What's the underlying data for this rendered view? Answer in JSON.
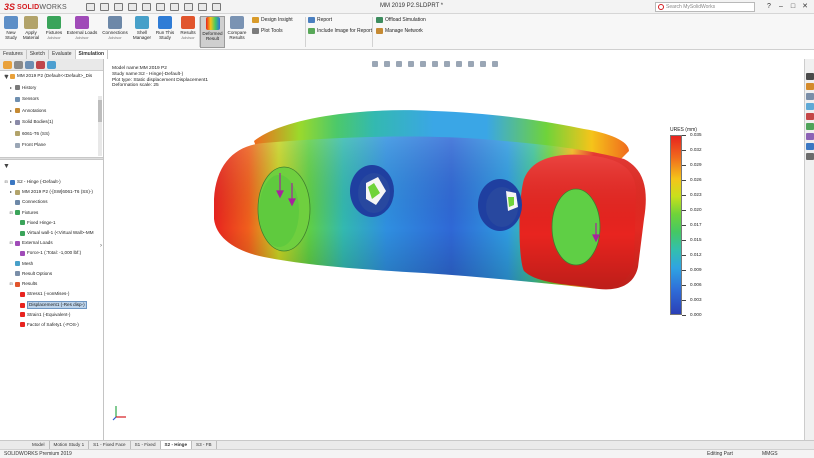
{
  "app": {
    "logo_ds": "3S",
    "logo_text_bold": "SOLID",
    "logo_text_thin": "WORKS",
    "doc_title": "MM 2019 P2.SLDPRT *",
    "search_placeholder": "Search MySolidWorks",
    "window_controls": [
      "?",
      "–",
      "□",
      "✕"
    ]
  },
  "ribbon": {
    "buttons": [
      {
        "label": "New",
        "sub": "Study",
        "icon": "new-study-icon"
      },
      {
        "label": "Apply",
        "sub": "Material",
        "icon": "apply-material-icon"
      },
      {
        "label": "Fixtures",
        "sub": "Advisor",
        "icon": "fixtures-icon"
      },
      {
        "label": "External Loads",
        "sub": "Advisor",
        "icon": "external-loads-icon"
      },
      {
        "label": "Connections",
        "sub": "Advisor",
        "icon": "connections-icon"
      },
      {
        "label": "Shell",
        "sub": "Manager",
        "icon": "shell-manager-icon"
      },
      {
        "label": "Run This",
        "sub": "Study",
        "icon": "run-study-icon"
      },
      {
        "label": "Results",
        "sub": "Advisor",
        "icon": "results-advisor-icon"
      },
      {
        "label": "Deformed",
        "sub": "Result",
        "icon": "deformed-result-icon"
      },
      {
        "label": "Compare",
        "sub": "Results",
        "icon": "compare-results-icon"
      }
    ],
    "small": [
      {
        "label": "Design Insight",
        "icon": "design-insight-icon"
      },
      {
        "label": "Plot Tools",
        "icon": "plot-tools-icon"
      },
      {
        "label": "Report",
        "icon": "report-icon"
      },
      {
        "label": "Include Image for Report",
        "icon": "include-image-icon"
      },
      {
        "label": "Offload Simulation",
        "icon": "offload-simulation-icon"
      },
      {
        "label": "Manage Network",
        "icon": "manage-network-icon"
      }
    ]
  },
  "command_tabs": [
    "Features",
    "Sketch",
    "Evaluate",
    "Simulation"
  ],
  "feature_tree": [
    {
      "label": "MM 2019 P2 (Default<<Default>_Dis",
      "indent": 0,
      "twisty": "⊟"
    },
    {
      "label": "History",
      "indent": 1,
      "twisty": "▸"
    },
    {
      "label": "Sensors",
      "indent": 1,
      "twisty": ""
    },
    {
      "label": "Annotations",
      "indent": 1,
      "twisty": "▸"
    },
    {
      "label": "Solid Bodies(1)",
      "indent": 1,
      "twisty": "▸"
    },
    {
      "label": "6061-T6 (SS)",
      "indent": 1,
      "twisty": ""
    },
    {
      "label": "Front Plane",
      "indent": 1,
      "twisty": ""
    }
  ],
  "study_tree": [
    {
      "label": "S2 - Hinge (-Default-)",
      "indent": 0,
      "twisty": "⊟"
    },
    {
      "label": "MM 2019 P2 (-[SW]6061-T6 (SS)-)",
      "indent": 1,
      "twisty": "▸"
    },
    {
      "label": "Connections",
      "indent": 1,
      "twisty": ""
    },
    {
      "label": "Fixtures",
      "indent": 1,
      "twisty": "⊟"
    },
    {
      "label": "Fixed Hinge-1",
      "indent": 2,
      "twisty": ""
    },
    {
      "label": "Virtual wall-1 (<Virtual Wall>-MM",
      "indent": 2,
      "twisty": ""
    },
    {
      "label": "External Loads",
      "indent": 1,
      "twisty": "⊟"
    },
    {
      "label": "Force-1 (:Total: -1,000 lbf:)",
      "indent": 2,
      "twisty": ""
    },
    {
      "label": "Mesh",
      "indent": 1,
      "twisty": ""
    },
    {
      "label": "Result Options",
      "indent": 1,
      "twisty": ""
    },
    {
      "label": "Results",
      "indent": 1,
      "twisty": "⊟"
    },
    {
      "label": "Stress1 (-vonMises-)",
      "indent": 2,
      "twisty": ""
    },
    {
      "label": "Displacement1 (-Res disp-)",
      "indent": 2,
      "twisty": "",
      "selected": true
    },
    {
      "label": "Strain1 (-Equivalent-)",
      "indent": 2,
      "twisty": ""
    },
    {
      "label": "Factor of Safety1 (-FOS-)",
      "indent": 2,
      "twisty": ""
    }
  ],
  "viewport": {
    "info_lines": [
      "Model name:MM 2019 P2",
      "Study name:S2 - Hinge(-Default-)",
      "Plot type: Static displacement Displacement1",
      "Deformation scale: 25"
    ]
  },
  "legend": {
    "title": "URES (mm)",
    "labels": [
      "0.035",
      "0.032",
      "0.029",
      "0.026",
      "0.023",
      "0.020",
      "0.017",
      "0.015",
      "0.012",
      "0.009",
      "0.006",
      "0.003",
      "0.000"
    ],
    "colors": {
      "max": "#e8231f",
      "mid": "#44c864",
      "min": "#2b3fb6"
    }
  },
  "bottom_tabs": [
    "Model",
    "Motion Study 1",
    "S1 - Fixed Face",
    "S1 - Fixed",
    "S2 - Hinge",
    "S3 - FB"
  ],
  "bottom_active": "S2 - Hinge",
  "status": {
    "left": "SOLIDWORKS Premium 2019",
    "mode": "Editing Part",
    "units": "MMGS"
  }
}
